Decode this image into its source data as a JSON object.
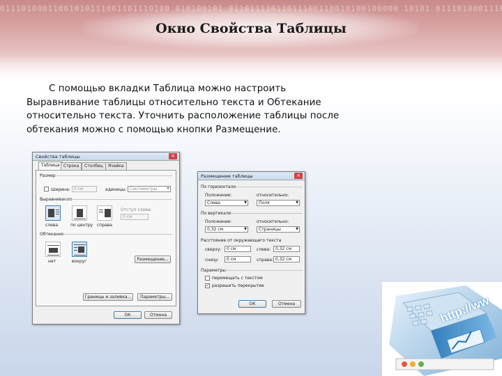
{
  "slide": {
    "title": "Окно Свойства Таблицы",
    "banner_digits": "01110100011001010111001101110100 010100101 01101111011011100110010100100000 10101 0111010001110111011011110010000001110100",
    "body_lines": [
      "С помощью вкладки Таблица можно настроить",
      "Выравнивание таблицы относительно текста и Обтекание",
      "относительно текста. Уточнить расположение таблицы после",
      "обтекания можно с помощью кнопки Размещение."
    ]
  },
  "table_props": {
    "window_title": "Свойства таблицы",
    "close_glyph": "×",
    "tabs": [
      "Таблица",
      "Строка",
      "Столбец",
      "Ячейка"
    ],
    "size_label": "Размер",
    "width_check_label": "Ширина:",
    "width_value": "0 см",
    "units_label": "единицы:",
    "units_value": "Сантиметры",
    "align_label": "Выравнивание",
    "indent_label": "Отступ слева:",
    "indent_value": "0 см",
    "align_options": [
      "слева",
      "по центру",
      "справа"
    ],
    "wrap_label": "Обтекание",
    "wrap_options": [
      "нет",
      "вокруг"
    ],
    "placement_button": "Размещение...",
    "borders_button": "Границы и заливка...",
    "params_button": "Параметры...",
    "ok_button": "ОК",
    "cancel_button": "Отмена"
  },
  "placement": {
    "window_title": "Размещение таблицы",
    "close_glyph": "×",
    "horizontal_label": "По горизонтали",
    "h_position_label": "Положение:",
    "h_position_value": "Слева",
    "h_relative_label": "относительно:",
    "h_relative_value": "Поля",
    "vertical_label": "По вертикали",
    "v_position_label": "Положение:",
    "v_position_value": "0,32 см",
    "v_relative_label": "относительно:",
    "v_relative_value": "Страницы",
    "distance_label": "Расстояние от окружающего текста",
    "top_label": "сверху:",
    "top_value": "0 см",
    "left_label": "слева:",
    "left_value": "0,32 см",
    "bottom_label": "снизу:",
    "bottom_value": "0 см",
    "right_label": "справа:",
    "right_value": "0,32 см",
    "params_label": "Параметры",
    "move_with_text": "перемещать с текстом",
    "allow_overlap": "разрешить перекрытие",
    "check_glyph": "✓",
    "ok_button": "ОК",
    "cancel_button": "Отмена"
  },
  "illustration_text": "http://ww"
}
